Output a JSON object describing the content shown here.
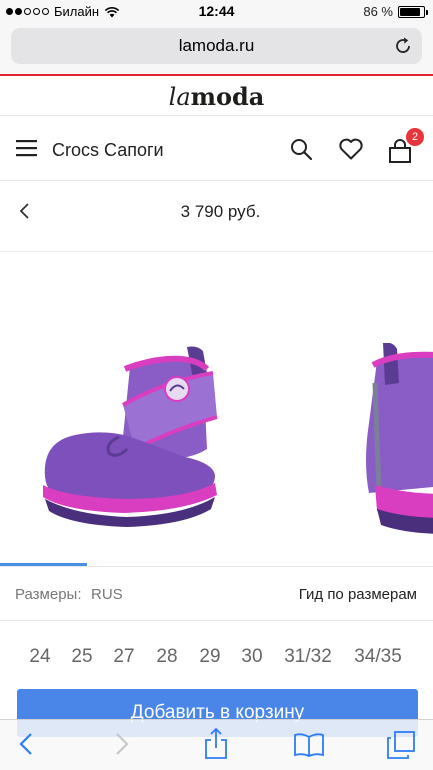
{
  "status_bar": {
    "carrier": "Билайн",
    "time": "12:44",
    "battery_text": "86 %",
    "battery_level": 0.86,
    "signal_bars_filled": 2,
    "signal_bars_total": 5
  },
  "browser": {
    "url": "lamoda.ru"
  },
  "logo": {
    "part1": "la",
    "part2": "moda"
  },
  "header": {
    "title": "Crocs Сапоги",
    "cart_count": "2"
  },
  "product": {
    "price": "3 790 руб."
  },
  "gallery": {
    "active_index": 1,
    "image_count": 5
  },
  "sizes": {
    "label": "Размеры:",
    "system": "RUS",
    "guide_link": "Гид по размерам",
    "items": [
      "24",
      "25",
      "27",
      "28",
      "29",
      "30",
      "31/32",
      "34/35"
    ]
  },
  "add_to_cart": {
    "label": "Добавить в корзину"
  },
  "colors": {
    "accent_red": "#e3232f",
    "badge_red": "#e8353c",
    "button_blue": "#4a86e8",
    "boot_purple": "#8a5cc5",
    "boot_pink": "#d93ec0"
  },
  "icons": {
    "menu": "hamburger-icon",
    "search": "search-icon",
    "wishlist": "heart-icon",
    "cart": "cart-icon",
    "reload": "reload-icon",
    "back": "chevron-left-icon",
    "share": "share-icon",
    "bookmarks": "book-icon",
    "tabs": "tabs-icon"
  }
}
